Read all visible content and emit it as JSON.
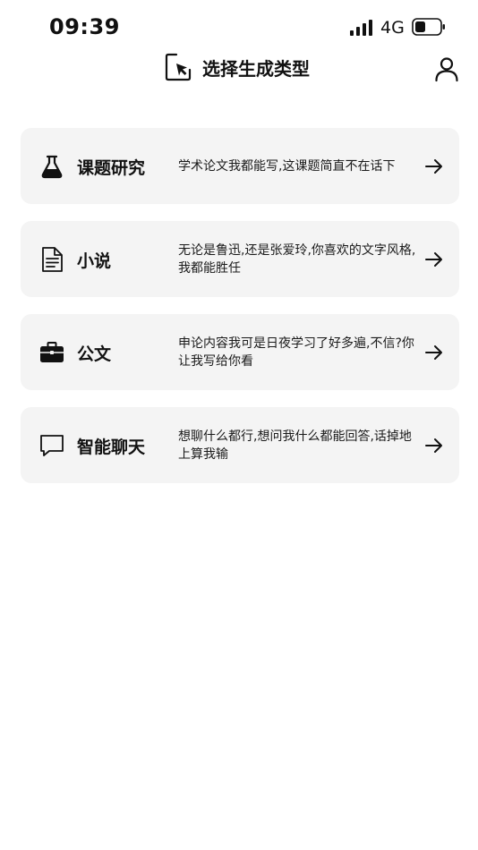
{
  "status_bar": {
    "time": "09:39",
    "network": "4G"
  },
  "header": {
    "title": "选择生成类型",
    "icons": {
      "title_icon": "cursor-select-icon",
      "profile_icon": "user-icon"
    }
  },
  "cards": [
    {
      "title": "课题研究",
      "description": "学术论文我都能写,这课题简直不在话下",
      "icon": "flask-icon"
    },
    {
      "title": "小说",
      "description": "无论是鲁迅,还是张爱玲,你喜欢的文字风格,我都能胜任",
      "icon": "document-icon"
    },
    {
      "title": "公文",
      "description": "申论内容我可是日夜学习了好多遍,不信?你让我写给你看",
      "icon": "briefcase-icon"
    },
    {
      "title": "智能聊天",
      "description": "想聊什么都行,想问我什么都能回答,话掉地上算我输",
      "icon": "chat-bubble-icon"
    }
  ],
  "colors": {
    "card_background": "#f4f4f4",
    "text": "#111111",
    "background": "#ffffff"
  }
}
